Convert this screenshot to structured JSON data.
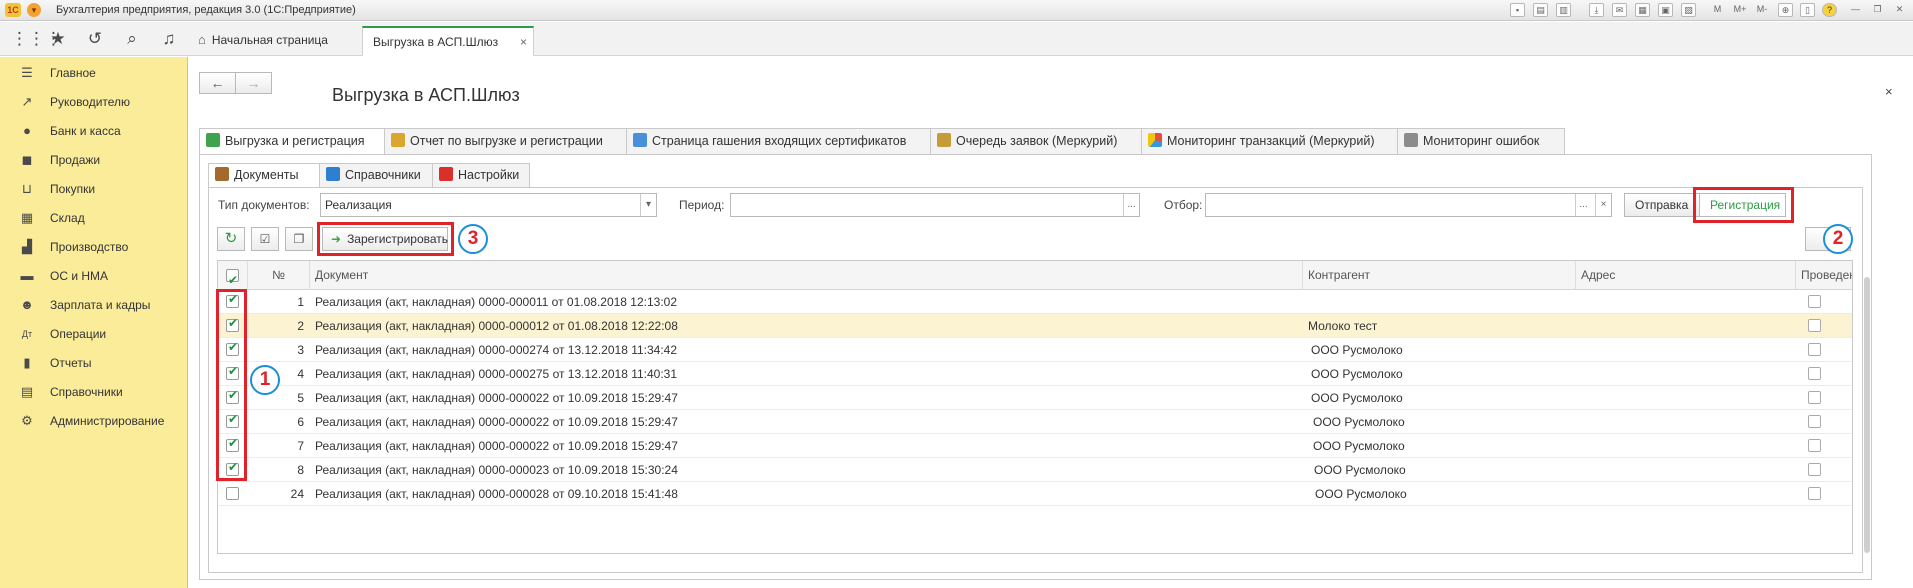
{
  "app": {
    "title": "Бухгалтерия предприятия, редакция 3.0  (1С:Предприятие)",
    "logo_text": "1С"
  },
  "titlebar_buttons": [
    "M",
    "M+",
    "M-",
    "?",
    "—",
    "❐",
    "✕"
  ],
  "page_tabs": {
    "home": "Начальная страница",
    "active": "Выгрузка в АСП.Шлюз",
    "close": "×"
  },
  "sidebar": {
    "items": [
      {
        "label": "Главное",
        "icon": "menu-lines-icon"
      },
      {
        "label": "Руководителю",
        "icon": "trend-up-icon"
      },
      {
        "label": "Банк и касса",
        "icon": "coin-icon"
      },
      {
        "label": "Продажи",
        "icon": "bag-icon"
      },
      {
        "label": "Покупки",
        "icon": "cart-icon"
      },
      {
        "label": "Склад",
        "icon": "warehouse-icon"
      },
      {
        "label": "Производство",
        "icon": "factory-icon"
      },
      {
        "label": "ОС и НМА",
        "icon": "truck-icon"
      },
      {
        "label": "Зарплата и кадры",
        "icon": "person-icon"
      },
      {
        "label": "Операции",
        "icon": "debit-credit-icon"
      },
      {
        "label": "Отчеты",
        "icon": "bar-chart-icon"
      },
      {
        "label": "Справочники",
        "icon": "book-icon"
      },
      {
        "label": "Администрирование",
        "icon": "gear-icon"
      }
    ]
  },
  "form": {
    "title": "Выгрузка в АСП.Шлюз",
    "back": "←",
    "forward": "→",
    "close": "×"
  },
  "main_tabs": [
    "Выгрузка и регистрация",
    "Отчет по выгрузке и регистрации",
    "Страница гашения входящих сертификатов",
    "Очередь заявок (Меркурий)",
    "Мониторинг транзакций (Меркурий)",
    "Мониторинг ошибок"
  ],
  "sub_tabs": [
    "Документы",
    "Справочники",
    "Настройки"
  ],
  "filters": {
    "doc_type_label": "Тип документов:",
    "doc_type_value": "Реализация",
    "period_label": "Период:",
    "period_value": "",
    "filter_label": "Отбор:",
    "filter_value": "",
    "dropdown_glyph": "▾",
    "ellipsis": "...",
    "clear": "×"
  },
  "mode_buttons": {
    "send": "Отправка",
    "register": "Регистрация"
  },
  "actions": {
    "register_button": "Зарегистрировать"
  },
  "callouts": [
    "1",
    "2",
    "3"
  ],
  "grid": {
    "columns": [
      "№",
      "Документ",
      "Контрагент",
      "Адрес",
      "Проведен"
    ],
    "rows": [
      {
        "checked": true,
        "num": "1",
        "doc": "Реализация (акт, накладная) 0000-000011 от 01.08.2018 12:13:02",
        "partner": "",
        "address": "",
        "posted": false
      },
      {
        "checked": true,
        "num": "2",
        "doc": "Реализация (акт, накладная) 0000-000012 от 01.08.2018 12:22:08",
        "partner": "Молоко тест",
        "address": "",
        "posted": false
      },
      {
        "checked": true,
        "num": "3",
        "doc": "Реализация (акт, накладная) 0000-000274 от 13.12.2018 11:34:42",
        "partner": "ООО Русмолоко",
        "address": "",
        "posted": false
      },
      {
        "checked": true,
        "num": "4",
        "doc": "Реализация (акт, накладная) 0000-000275 от 13.12.2018 11:40:31",
        "partner": "ООО Русмолоко",
        "address": "",
        "posted": false
      },
      {
        "checked": true,
        "num": "5",
        "doc": "Реализация (акт, накладная) 0000-000022 от 10.09.2018 15:29:47",
        "partner": "ООО Русмолоко",
        "address": "",
        "posted": false
      },
      {
        "checked": true,
        "num": "6",
        "doc": "Реализация (акт, накладная) 0000-000022 от 10.09.2018 15:29:47",
        "partner": "ООО Русмолоко",
        "address": "",
        "posted": false
      },
      {
        "checked": true,
        "num": "7",
        "doc": "Реализация (акт, накладная) 0000-000022 от 10.09.2018 15:29:47",
        "partner": "ООО Русмолоко",
        "address": "",
        "posted": false
      },
      {
        "checked": true,
        "num": "8",
        "doc": "Реализация (акт, накладная) 0000-000023 от 10.09.2018 15:30:24",
        "partner": "ООО Русмолоко",
        "address": "",
        "posted": false
      },
      {
        "checked": false,
        "num": "24",
        "doc": "Реализация (акт, накладная) 0000-000028 от 09.10.2018 15:41:48",
        "partner": "ООО Русмолоко",
        "address": "",
        "posted": false
      }
    ]
  },
  "colors": {
    "sidebar_bg": "#fbec9a",
    "accent_green": "#2c9b45",
    "callout_red": "#e0222b",
    "callout_blue": "#1b8fd6",
    "selected_row": "#fbf3d1"
  }
}
